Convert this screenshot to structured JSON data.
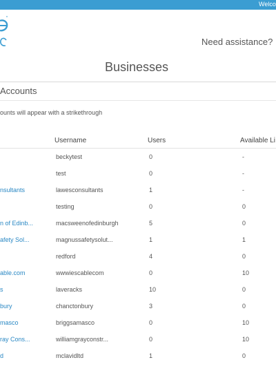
{
  "header": {
    "welcome": "Welco",
    "assistance": "Need assistance? E"
  },
  "page": {
    "title": "Businesses",
    "section_title": "Accounts",
    "note": "ounts will appear with a strikethrough"
  },
  "table": {
    "columns": [
      "Username",
      "Users",
      "Available Li"
    ],
    "rows": [
      {
        "name": "",
        "username": "beckytest",
        "users": "0",
        "available": "-"
      },
      {
        "name": "",
        "username": "test",
        "users": "0",
        "available": "-"
      },
      {
        "name": "nsultants",
        "username": "lawesconsultants",
        "users": "1",
        "available": "-"
      },
      {
        "name": "",
        "username": "testing",
        "users": "0",
        "available": "0"
      },
      {
        "name": "n of Edinb...",
        "username": "macsweenofedinburgh",
        "users": "5",
        "available": "0"
      },
      {
        "name": "afety Sol...",
        "username": "magnussafetysolut...",
        "users": "1",
        "available": "1"
      },
      {
        "name": "",
        "username": "redford",
        "users": "4",
        "available": "0"
      },
      {
        "name": "able.com",
        "username": "wwwiescablecom",
        "users": "0",
        "available": "10"
      },
      {
        "name": "s",
        "username": "laveracks",
        "users": "10",
        "available": "0"
      },
      {
        "name": "bury",
        "username": "chanctonbury",
        "users": "3",
        "available": "0"
      },
      {
        "name": "masco",
        "username": "briggsamasco",
        "users": "0",
        "available": "10"
      },
      {
        "name": "ray Cons...",
        "username": "williamgrayconstr...",
        "users": "0",
        "available": "10"
      },
      {
        "name": "d",
        "username": "mclavidltd",
        "users": "1",
        "available": "0"
      }
    ]
  },
  "colors": {
    "topbar": "#3b9dd2",
    "link": "#2a88c4",
    "logo": "#3b9dd2"
  }
}
